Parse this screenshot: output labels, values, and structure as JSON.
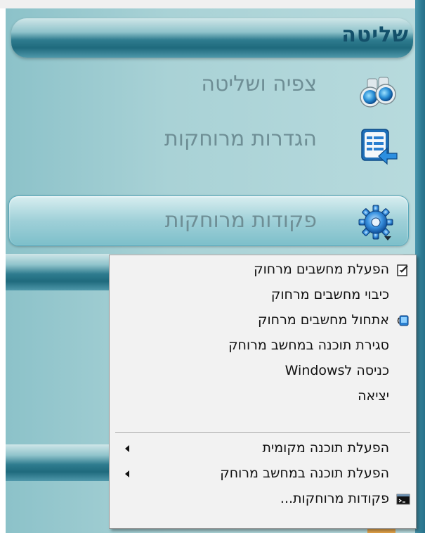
{
  "panel": {
    "title": "שליטה"
  },
  "nav": {
    "items": [
      {
        "label": "צפיה ושליטה",
        "icon": "binoculars-icon",
        "active": false
      },
      {
        "label": "הגדרות מרוחקות",
        "icon": "settings-list-icon",
        "active": false
      },
      {
        "label": "פקודות מרוחקות",
        "icon": "gear-icon",
        "active": true
      }
    ]
  },
  "context_menu": {
    "items": [
      {
        "label": "הפעלת מחשבים מרחוק",
        "icon": "power-on-icon",
        "submenu": false
      },
      {
        "label": "כיבוי מחשבים מרחוק",
        "icon": "",
        "submenu": false
      },
      {
        "label": "אתחול מחשבים מרחוק",
        "icon": "restart-icon",
        "submenu": false
      },
      {
        "label": "סגירת תוכנה במחשב מרוחק",
        "icon": "",
        "submenu": false
      },
      {
        "label": "כניסה לWindows",
        "icon": "",
        "submenu": false
      },
      {
        "label": "יציאה",
        "icon": "",
        "submenu": false
      },
      {
        "label": "הפעלת תוכנה מקומית",
        "icon": "",
        "submenu": true
      },
      {
        "label": "הפעלת תוכנה במחשב מרוחק",
        "icon": "",
        "submenu": true
      },
      {
        "label": "פקודות מרוחקות...",
        "icon": "command-prompt-icon",
        "submenu": false
      }
    ]
  },
  "colors": {
    "accent": "#1f6a7d",
    "panel_bg": "#a9d2d6",
    "header_text": "#13506a",
    "nav_text": "#6e8e95"
  }
}
